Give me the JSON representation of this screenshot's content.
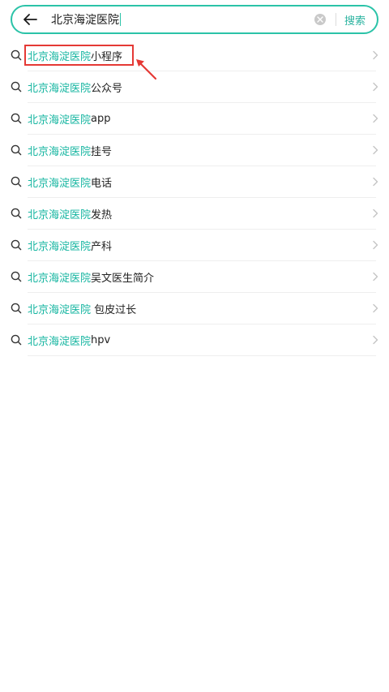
{
  "search": {
    "query": "北京海淀医院",
    "button_label": "搜索"
  },
  "suggestions": [
    {
      "highlight": "北京海淀医院",
      "rest": "小程序"
    },
    {
      "highlight": "北京海淀医院",
      "rest": "公众号"
    },
    {
      "highlight": "北京海淀医院",
      "rest": "app"
    },
    {
      "highlight": "北京海淀医院",
      "rest": "挂号"
    },
    {
      "highlight": "北京海淀医院",
      "rest": "电话"
    },
    {
      "highlight": "北京海淀医院",
      "rest": "发热"
    },
    {
      "highlight": "北京海淀医院",
      "rest": "产科"
    },
    {
      "highlight": "北京海淀医院",
      "rest": "吴文医生简介"
    },
    {
      "highlight": "北京海淀医院",
      "rest": " 包皮过长"
    },
    {
      "highlight": "北京海淀医院",
      "rest": "hpv"
    }
  ],
  "colors": {
    "accent": "#2bc3a8",
    "highlight_text": "#14b5a0",
    "annotation": "#e53935"
  },
  "icons": {
    "back": "arrow-left-icon",
    "clear": "clear-icon",
    "query": "search-icon",
    "chevron": "chevron-right-icon"
  }
}
